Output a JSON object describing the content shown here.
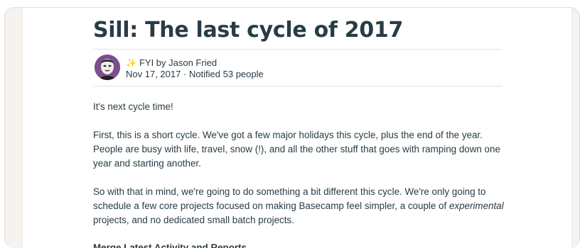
{
  "post": {
    "title": "Sill: The last cycle of 2017",
    "byline": "FYI by Jason Fried",
    "date": "Nov 17, 2017",
    "separator": "·",
    "notified": "Notified 53 people",
    "icons": {
      "category": "sparkle-icon",
      "author": "avatar"
    },
    "colors": {
      "heading": "#283c46",
      "sparkle": "#f2b705",
      "avatar": "#7a4f8c"
    }
  },
  "body": {
    "p1": "It's next cycle time!",
    "p2": "First, this is a short cycle. We've got a few major holidays this cycle, plus the end of the year. People are busy with life, travel, snow (!), and all the other stuff that goes with ramping down one year and starting another.",
    "p3_part1": "So with that in mind, we're going to do something a bit different this cycle. We're only going to schedule a few core projects focused on making Basecamp feel simpler, a couple of ",
    "p3_em": "experimental",
    "p3_part2": " projects, and no dedicated small batch projects.",
    "next_heading": "Merge Latest Activity and Reports"
  }
}
